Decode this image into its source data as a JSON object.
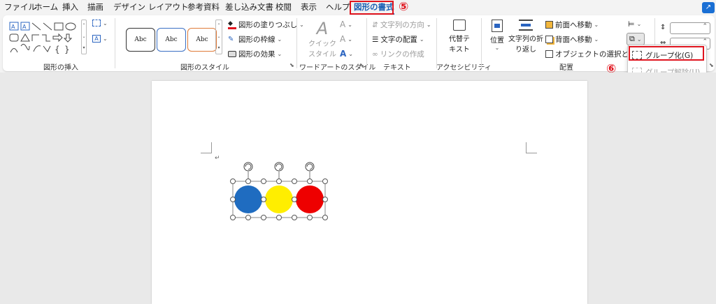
{
  "tabs": [
    "ファイル",
    "ホーム",
    "挿入",
    "描画",
    "デザイン",
    "レイアウト",
    "参考資料",
    "差し込み文書",
    "校閲",
    "表示",
    "ヘルプ",
    "図形の書式"
  ],
  "annotations": {
    "step5": "⑤",
    "step6": "⑥"
  },
  "groups": {
    "insert_shapes": "図形の挿入",
    "shape_styles": "図形のスタイル",
    "wordart_styles": "ワードアートのスタイル",
    "text": "テキスト",
    "accessibility": "アクセシビリティ",
    "arrange": "配置"
  },
  "shape_styles": {
    "gallery": [
      {
        "label": "Abc",
        "color": "#333333"
      },
      {
        "label": "Abc",
        "color": "#3a6fc4"
      },
      {
        "label": "Abc",
        "color": "#e07b39"
      }
    ],
    "fill": "図形の塗りつぶし",
    "outline": "図形の枠線",
    "effects": "図形の効果"
  },
  "wordart": {
    "quick_styles_1": "クイック",
    "quick_styles_2": "スタイル"
  },
  "text_group": {
    "direction": "文字列の方向",
    "align": "文字の配置",
    "link": "リンクの作成"
  },
  "accessibility_group": {
    "alt_text_1": "代替テ",
    "alt_text_2": "キスト"
  },
  "arrange": {
    "position": "位置",
    "wrap_1": "文字列の折",
    "wrap_2": "り返し",
    "bring_forward": "前面へ移動",
    "send_backward": "背面へ移動",
    "selection_pane": "オブジェクトの選択と表示"
  },
  "group_menu": {
    "group": "グループ化(G)",
    "ungroup": "グループ解除(U)"
  },
  "document": {
    "circles": [
      {
        "color": "#1f6cc0"
      },
      {
        "color": "#ffee00"
      },
      {
        "color": "#ee0000"
      }
    ]
  },
  "colors": {
    "accent": "#1a5fb4",
    "highlight": "#e0141e"
  }
}
